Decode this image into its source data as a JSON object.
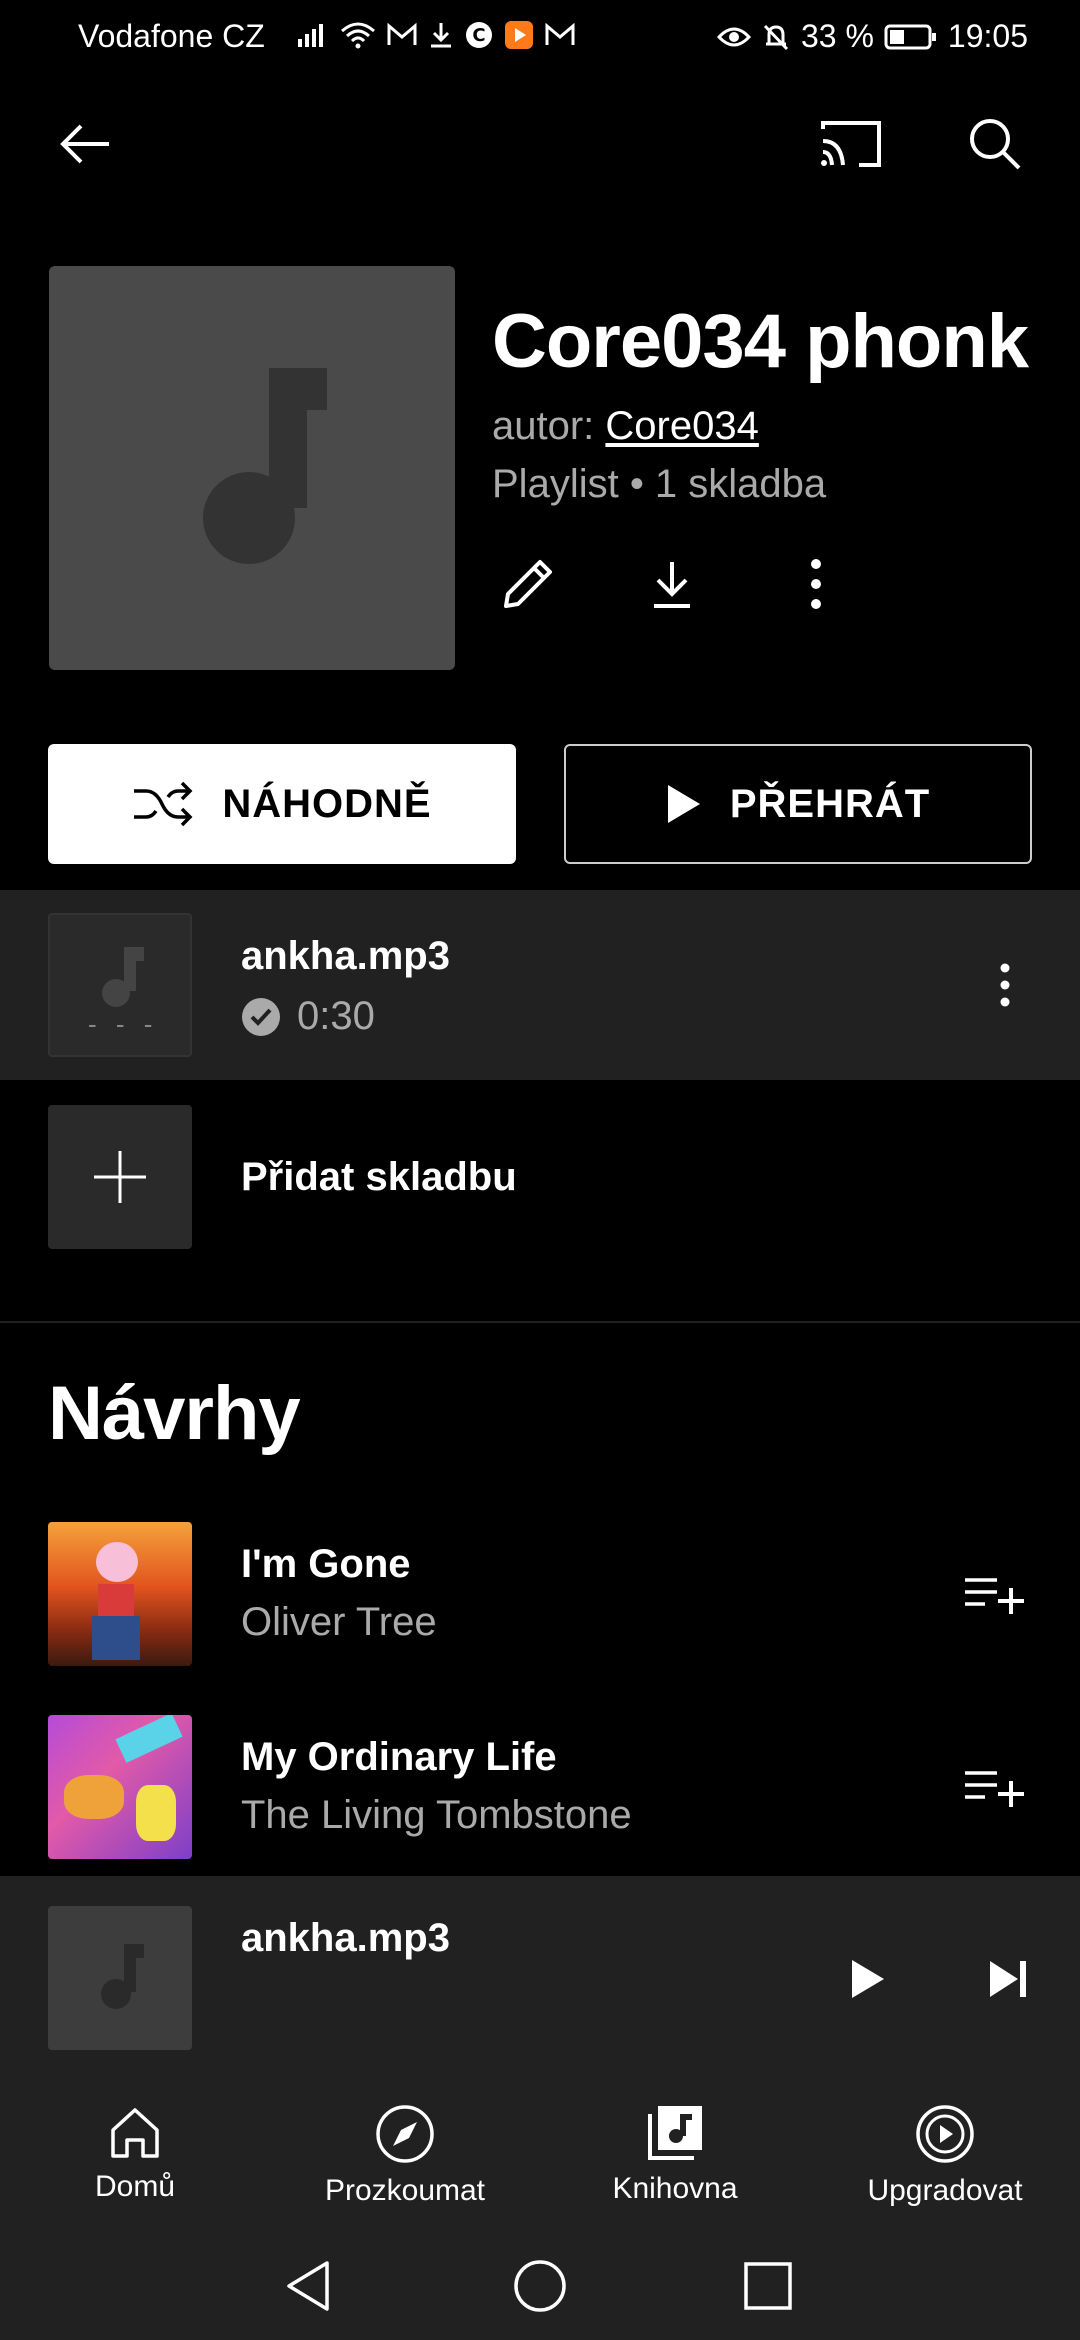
{
  "status_bar": {
    "carrier": "Vodafone CZ",
    "battery": "33 %",
    "time": "19:05"
  },
  "top_bar": {
    "back_icon": "arrow-left-icon",
    "cast_icon": "cast-icon",
    "search_icon": "search-icon"
  },
  "playlist": {
    "title": "Core034 phonk",
    "author_prefix": "autor: ",
    "author": "Core034",
    "meta": "Playlist • 1 skladba"
  },
  "actions": {
    "shuffle_label": "NÁHODNĚ",
    "play_label": "PŘEHRÁT"
  },
  "tracks": [
    {
      "title": "ankha.mp3",
      "duration": "0:30"
    }
  ],
  "add_track_label": "Přidat skladbu",
  "suggestions": {
    "heading": "Návrhy",
    "items": [
      {
        "title": "I'm Gone",
        "artist": "Oliver Tree"
      },
      {
        "title": "My Ordinary Life",
        "artist": "The Living Tombstone"
      }
    ]
  },
  "mini_player": {
    "title": "ankha.mp3"
  },
  "bottom_nav": [
    {
      "label": "Domů",
      "icon": "home-icon"
    },
    {
      "label": "Prozkoumat",
      "icon": "explore-icon"
    },
    {
      "label": "Knihovna",
      "icon": "library-icon"
    },
    {
      "label": "Upgradovat",
      "icon": "upgrade-icon"
    }
  ],
  "colors": {
    "background": "#000000",
    "surface": "#212121",
    "secondary_text": "#aaaaaa"
  }
}
